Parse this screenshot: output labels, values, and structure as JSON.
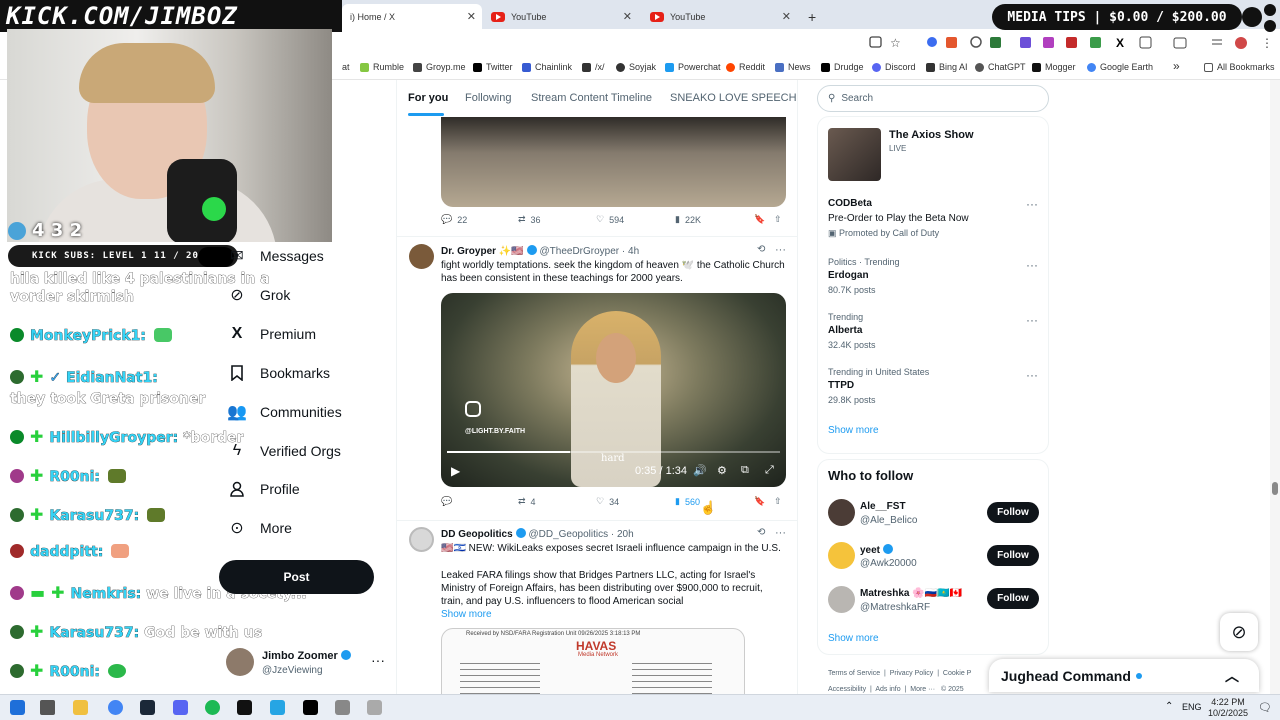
{
  "browser": {
    "tabs": [
      {
        "label": "i) Home / X",
        "active": true
      },
      {
        "label": "YouTube",
        "active": false
      },
      {
        "label": "YouTube",
        "active": false
      }
    ],
    "new_tab": "+",
    "bookmarks": [
      "at",
      "Rumble",
      "Groyp.me",
      "Twitter",
      "Chainlink",
      "/x/",
      "Soyjak",
      "Powerchat",
      "Reddit",
      "News",
      "Drudge",
      "Discord",
      "Bing AI",
      "ChatGPT",
      "Mogger",
      "Google Earth"
    ],
    "bookmarks_more": "»",
    "all_bookmarks": "All Bookmarks"
  },
  "stream": {
    "banner": "KICK.COM/JIMBOZ",
    "viewers": "4 3 2",
    "kick_subs": "KICK SUBS: LEVEL 1 11 / 20",
    "media_tips": "MEDIA TIPS | $0.00 / $200.00",
    "chat": [
      {
        "text": "hila killed like 4 palestinians in a vorder skirmish"
      },
      {
        "user": "MonkeyPrick1:",
        "msg": ""
      },
      {
        "user": "EidianNat1:",
        "msg": ""
      },
      {
        "text": "they took Greta prisoner"
      },
      {
        "user": "HillbillyGroyper:",
        "msg": "*border"
      },
      {
        "user": "R00ni:",
        "msg": ""
      },
      {
        "user": "Karasu737:",
        "msg": ""
      },
      {
        "user": "daddpitt:",
        "msg": ""
      },
      {
        "user": "Nemkris:",
        "msg": "we live in a socety..."
      },
      {
        "user": "Karasu737:",
        "msg": "God be with us"
      },
      {
        "user": "R00ni:",
        "msg": ""
      }
    ]
  },
  "nav": {
    "items": [
      "Messages",
      "Grok",
      "Premium",
      "Bookmarks",
      "Communities",
      "Verified Orgs",
      "Profile",
      "More"
    ],
    "post": "Post",
    "account_name": "Jimbo Zoomer",
    "account_handle": "@JzeViewing"
  },
  "timeline": {
    "tabs": [
      "For you",
      "Following",
      "Stream Content Timeline",
      "SNEAKO LOVE SPEECH"
    ],
    "tweet0_stats": {
      "replies": "22",
      "reposts": "36",
      "likes": "594",
      "views": "22K"
    },
    "tweet1": {
      "name": "Dr. Groyper",
      "handle": "@TheeDrGroyper",
      "time": "· 4h",
      "text": "fight worldly temptations. seek the kingdom of heaven 🕊️ the Catholic Church has been consistent in these teachings for 2000 years.",
      "watermark": "@LIGHT.BY.FAITH",
      "caption": "hard",
      "video_time": "0:35 / 1:34",
      "video_progress": 0.37,
      "stats": {
        "replies": "",
        "reposts": "4",
        "likes": "34",
        "views": "560"
      }
    },
    "tweet2": {
      "name": "DD Geopolitics",
      "handle": "@DD_Geopolitics",
      "time": "· 20h",
      "line1": "🇺🇸🇮🇱 NEW: WikiLeaks exposes secret Israeli influence campaign in the U.S.",
      "body": "Leaked FARA filings show that Bridges Partners LLC, acting for Israel's Ministry of Foreign Affairs, has been distributing over $900,000 to recruit, train, and pay U.S. influencers to flood American social",
      "show_more": "Show more",
      "doc_header": "Received by NSD/FARA Registration Unit 09/26/2025 3:18:13 PM",
      "doc_brand": "HAVAS",
      "doc_sub": "Media Network"
    }
  },
  "right": {
    "search_placeholder": "Search",
    "live_title": "The Axios Show",
    "live_label": "LIVE",
    "ad_title": "CODBeta",
    "ad_text": "Pre-Order to Play the Beta Now",
    "ad_promoted": "Promoted by Call of Duty",
    "trends": [
      {
        "context": "Politics · Trending",
        "name": "Erdogan",
        "posts": "80.7K posts"
      },
      {
        "context": "Trending",
        "name": "Alberta",
        "posts": "32.4K posts"
      },
      {
        "context": "Trending in United States",
        "name": "TTPD",
        "posts": "29.8K posts"
      }
    ],
    "show_more": "Show more",
    "wtf_title": "Who to follow",
    "follow": [
      {
        "name": "Ale__FST",
        "handle": "@Ale_Belico"
      },
      {
        "name": "yeet",
        "handle": "@Awk20000"
      },
      {
        "name": "Matreshka 🌸🇷🇺🇰🇿🇨🇦",
        "handle": "@MatreshkaRF"
      }
    ],
    "follow_label": "Follow",
    "footer1": [
      "Terms of Service",
      "Privacy Policy",
      "Cookie P"
    ],
    "footer2": [
      "Accessibility",
      "Ads info",
      "More ···",
      "© 2025"
    ],
    "chat_popup": "Jughead Command"
  },
  "taskbar": {
    "lang": "ENG",
    "time": "4:22 PM",
    "date": "10/2/2025"
  },
  "colors": {
    "accent": "#1d9bf0",
    "chat_user": "#35d3f5",
    "kick_green": "#28d03c"
  }
}
